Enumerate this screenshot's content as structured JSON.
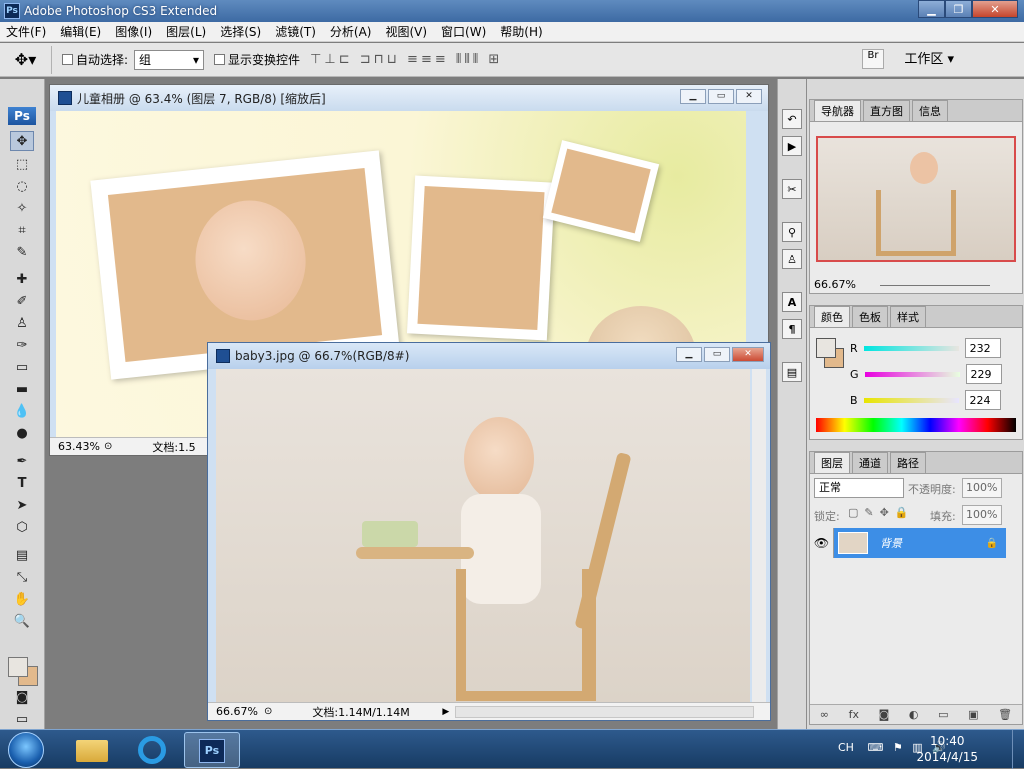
{
  "app": {
    "title": "Adobe Photoshop CS3 Extended",
    "logo": "Ps"
  },
  "menu": [
    "文件(F)",
    "编辑(E)",
    "图像(I)",
    "图层(L)",
    "选择(S)",
    "滤镜(T)",
    "分析(A)",
    "视图(V)",
    "窗口(W)",
    "帮助(H)"
  ],
  "options": {
    "auto_select_label": "自动选择:",
    "auto_select_value": "组",
    "show_transform_label": "显示变换控件",
    "workspace_label": "工作区 ▾"
  },
  "doc1": {
    "title": "儿童相册 @ 63.4% (图层 7, RGB/8) [缩放后]",
    "zoom": "63.43%",
    "doc_info": "文档:1.5"
  },
  "doc2": {
    "title": "baby3.jpg @ 66.7%(RGB/8#)",
    "zoom": "66.67%",
    "doc_info": "文档:1.14M/1.14M"
  },
  "navigator": {
    "tabs": [
      "导航器",
      "直方图",
      "信息"
    ],
    "zoom": "66.67%"
  },
  "color": {
    "tabs": [
      "颜色",
      "色板",
      "样式"
    ],
    "r_label": "R",
    "g_label": "G",
    "b_label": "B",
    "r": "232",
    "g": "229",
    "b": "224",
    "fg_color": "#e8e5e0",
    "bg_color": "#e2b98c"
  },
  "layers": {
    "tabs": [
      "图层",
      "通道",
      "路径"
    ],
    "blend_mode": "正常",
    "opacity_label": "不透明度:",
    "opacity": "100%",
    "lock_label": "锁定:",
    "fill_label": "填充:",
    "fill": "100%",
    "layer_name": "背景"
  },
  "taskbar": {
    "lang": "CH",
    "time": "10:40",
    "date": "2014/4/15"
  }
}
